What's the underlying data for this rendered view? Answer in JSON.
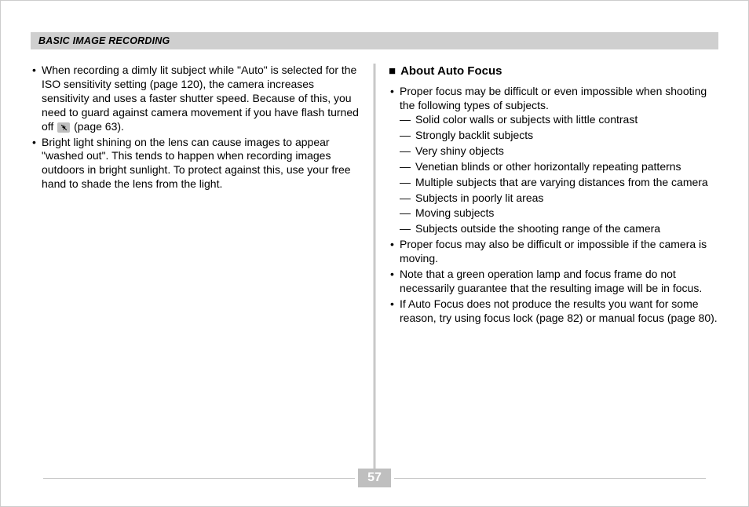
{
  "header": {
    "title": "BASIC IMAGE RECORDING"
  },
  "page_number": "57",
  "left": {
    "bullets": [
      {
        "pre": "When recording a dimly lit subject while \"Auto\" is selected for the ISO sensitivity setting (page 120), the camera increases sensitivity and uses a faster shutter speed. Because of this, you need to guard against camera movement if you have flash turned off ",
        "post": " (page 63)."
      },
      {
        "text": "Bright light shining on the lens can cause images to appear \"washed out\". This tends to happen when recording images outdoors in bright sunlight. To protect against this, use your free hand to shade the lens from the light."
      }
    ]
  },
  "right": {
    "heading": "About Auto Focus",
    "bullets": [
      {
        "text": "Proper focus may be difficult or even impossible when shooting the following types of subjects.",
        "dashes": [
          "Solid color walls or subjects with little contrast",
          "Strongly backlit subjects",
          "Very shiny objects",
          "Venetian blinds or other horizontally repeating patterns",
          "Multiple subjects that are varying distances from the camera",
          "Subjects in poorly lit areas",
          "Moving subjects",
          "Subjects outside the shooting range of the camera"
        ]
      },
      {
        "text": "Proper focus may also be difficult or impossible if the camera is moving."
      },
      {
        "text": "Note that a green operation lamp and focus frame do not necessarily guarantee that the resulting image will be in focus."
      },
      {
        "text": "If Auto Focus does not produce the results you want for some reason, try using focus lock (page 82) or manual focus (page 80)."
      }
    ]
  }
}
